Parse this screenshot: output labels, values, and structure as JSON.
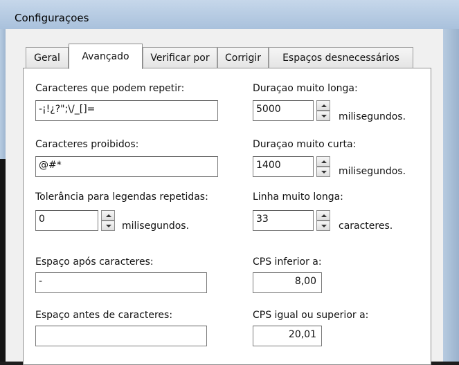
{
  "window": {
    "title": "Configuraçoes"
  },
  "tabs": [
    "Geral",
    "Avançado",
    "Verificar por",
    "Corrigir",
    "Espaços desnecessários"
  ],
  "active_tab": "Avançado",
  "left": {
    "repeat_label": "Caracteres que podem repetir:",
    "repeat_value": "-¡!¿?\";\\/_[]=",
    "forbidden_label": "Caracteres proibidos:",
    "forbidden_value": "@#*",
    "tolerance_label": "Tolerância para legendas repetidas:",
    "tolerance_value": "0",
    "tolerance_unit": "milisegundos.",
    "space_after_label": "Espaço após caracteres:",
    "space_after_value": "-",
    "space_before_label": "Espaço antes de caracteres:",
    "space_before_value": ""
  },
  "right": {
    "long_duration_label": "Duraçao muito longa:",
    "long_duration_value": "5000",
    "long_duration_unit": "milisegundos.",
    "short_duration_label": "Duraçao muito curta:",
    "short_duration_value": "1400",
    "short_duration_unit": "milisegundos.",
    "long_line_label": "Linha muito longa:",
    "long_line_value": "33",
    "long_line_unit": "caracteres.",
    "cps_lower_label": "CPS inferior a:",
    "cps_lower_value": "8,00",
    "cps_upper_label": "CPS igual ou superior a:",
    "cps_upper_value": "20,01"
  }
}
